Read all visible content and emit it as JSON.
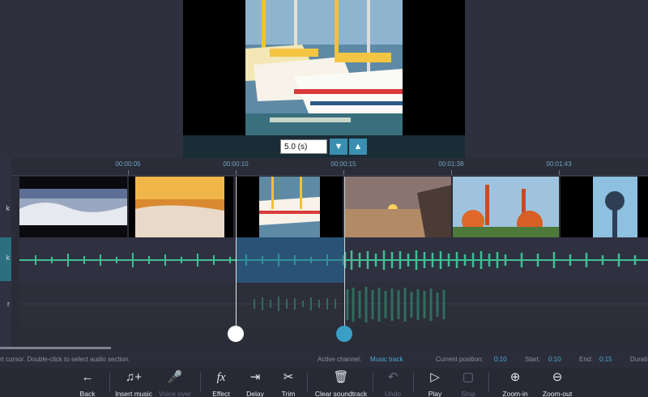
{
  "preview": {
    "duration_value": "5.0 (s)"
  },
  "tracks": {
    "video_label": "k",
    "music_label": "k",
    "voice_label": "r"
  },
  "ruler": {
    "ticks": [
      "00:00:05",
      "00:00:10",
      "00:00:15",
      "00:01:38",
      "00:01:43"
    ]
  },
  "status": {
    "hint": "rt cursor. Double-click to select audio section.",
    "active_channel_label": "Active channel:",
    "active_channel_value": "Music track",
    "current_position_label": "Current position:",
    "current_position_value": "0:10",
    "start_label": "Start:",
    "start_value": "0:10",
    "end_label": "End:",
    "end_value": "0:15",
    "duration_label": "Durati"
  },
  "toolbar": {
    "back": "Back",
    "insert_music": "Insert music",
    "voice_over": "Voice over",
    "effect": "Effect",
    "delay": "Delay",
    "trim": "Trim",
    "clear_soundtrack": "Clear soundtrack",
    "undo": "Undo",
    "play": "Play",
    "stop": "Stop",
    "zoom_in": "Zoom-in",
    "zoom_out": "Zoom-out"
  },
  "colors": {
    "accent": "#3a9fc4",
    "waveform": "#3fbf93",
    "selection": "#266ea0"
  }
}
